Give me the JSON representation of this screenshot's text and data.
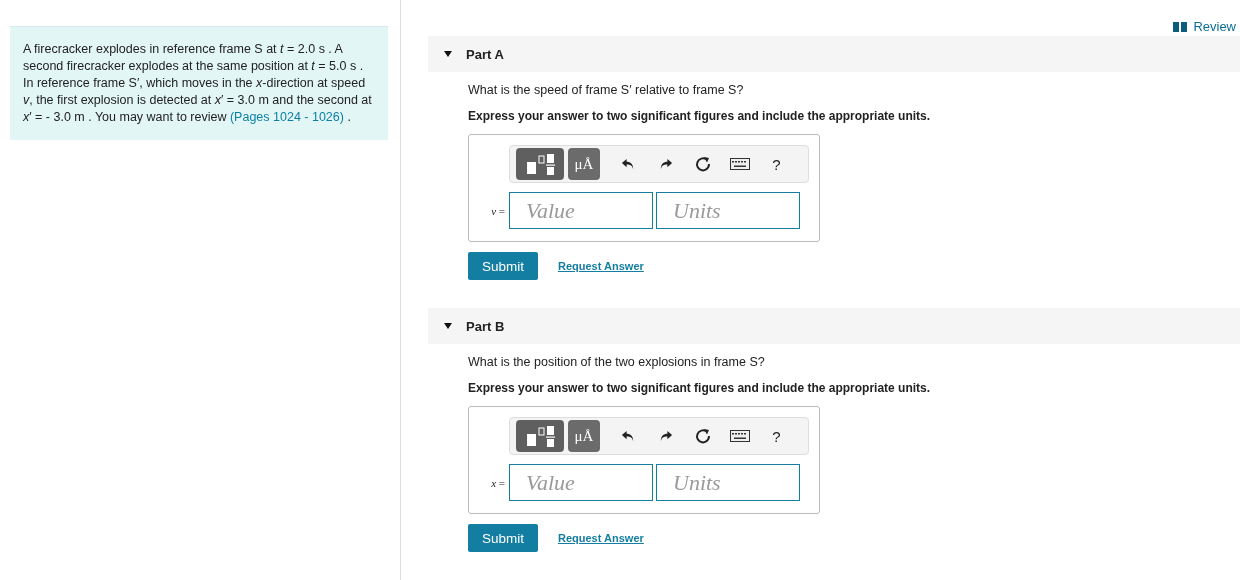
{
  "review_link": "Review",
  "problem": {
    "text": "A firecracker explodes in reference frame S at *t* = 2.0 s . A second firecracker explodes at the same position at *t* = 5.0 s . In reference frame S′, which moves in the *x*-direction at speed *v*, the first explosion is detected at *x*′ = 3.0 m and the second at *x*′ = - 3.0 m . You may want to review",
    "link": "(Pages 1024 - 1026)",
    "tail": " ."
  },
  "parts": [
    {
      "title": "Part A",
      "expanded": true,
      "question": "What is the speed of frame S′ relative to frame S?",
      "instruction": "Express your answer to two significant figures and include the appropriate units.",
      "units_tool": "μÅ",
      "help_tool": "?",
      "variable": "*v* =",
      "value_placeholder": "Value",
      "units_placeholder": "Units",
      "submit": "Submit",
      "request": "Request Answer"
    },
    {
      "title": "Part B",
      "expanded": true,
      "question": "What is the position of the two explosions in frame S?",
      "instruction": "Express your answer to two significant figures and include the appropriate units.",
      "units_tool": "μÅ",
      "help_tool": "?",
      "variable": "*x* =",
      "value_placeholder": "Value",
      "units_placeholder": "Units",
      "submit": "Submit",
      "request": "Request Answer"
    }
  ]
}
